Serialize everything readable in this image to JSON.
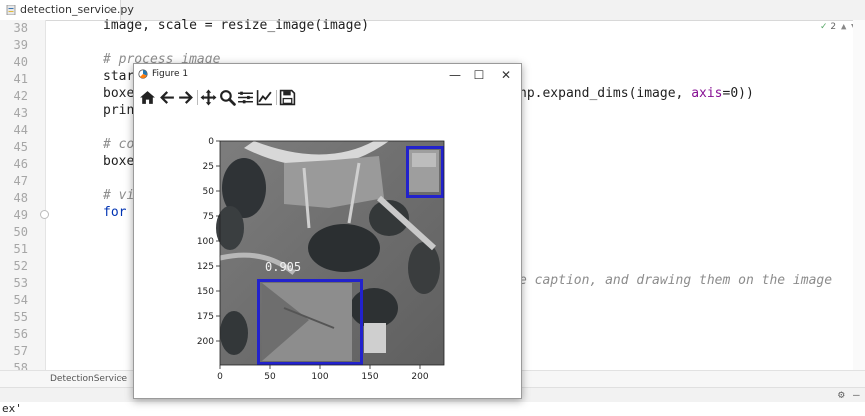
{
  "editor": {
    "tab": {
      "filename": "detection_service.py",
      "close": "×"
    },
    "inspection": {
      "check": "✓",
      "count": "2"
    },
    "line_numbers": [
      "38",
      "39",
      "40",
      "41",
      "42",
      "43",
      "44",
      "45",
      "46",
      "47",
      "48",
      "49",
      "50",
      "51",
      "52",
      "53",
      "54",
      "55",
      "56",
      "57",
      "58"
    ],
    "code": {
      "l38": "image, scale = resize_image(image)",
      "l40": "# process image",
      "l41": "start",
      "l42_a": "boxes",
      "l42_b": "np.expand_dims(image, ",
      "l42_c": "axis",
      "l42_d": "=0))",
      "l43": "print",
      "l45": "# co",
      "l46": "boxes",
      "l48": "# vi",
      "l49_kw": "for",
      "l49_rest": " b",
      "l53": "e caption, and drawing them on the image"
    }
  },
  "breadcrumb": {
    "item": "DetectionService",
    "sep": "›"
  },
  "console": {
    "output": "ex'"
  },
  "figure": {
    "title": "Figure 1",
    "window_buttons": {
      "minimize": "—",
      "maximize": "☐",
      "close": "✕"
    },
    "toolbar": [
      "home-icon",
      "back-icon",
      "forward-icon",
      "pan-icon",
      "zoom-icon",
      "configure-subplots-icon",
      "edit-axes-icon",
      "save-icon"
    ],
    "detection_score": "0.905",
    "box_color": "#2222cc"
  },
  "chart_data": {
    "type": "image",
    "x_ticks": [
      0,
      50,
      100,
      150,
      200
    ],
    "y_ticks": [
      0,
      25,
      50,
      75,
      100,
      125,
      150,
      175,
      200
    ],
    "xlim": [
      0,
      224
    ],
    "ylim": [
      224,
      0
    ],
    "boxes": [
      {
        "x0": 186,
        "y0": 5,
        "x1": 224,
        "y1": 57,
        "score": ""
      },
      {
        "x0": 37,
        "y0": 138,
        "x1": 143,
        "y1": 224,
        "score": "0.905"
      }
    ]
  }
}
